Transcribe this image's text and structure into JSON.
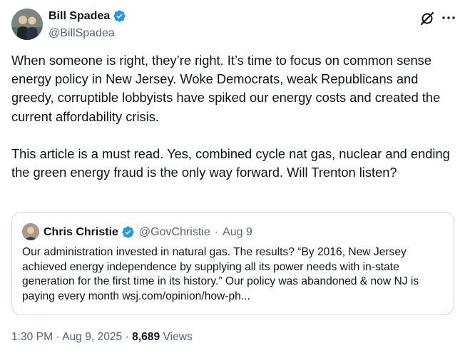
{
  "author": {
    "name": "Bill Spadea",
    "handle": "@BillSpadea"
  },
  "tweet": {
    "text": "When someone is right, they’re right. It’s time to focus on common sense energy policy in New Jersey. Woke Democrats, weak Republicans and greedy, corruptible lobbyists have spiked our energy costs and created the current affordability crisis.\n\nThis article is a must read. Yes, combined cycle nat gas, nuclear and ending the green energy fraud is the only way forward. Will Trenton listen?"
  },
  "quote": {
    "name": "Chris Christie",
    "handle": "@GovChristie",
    "date": "Aug 9",
    "text": "Our administration invested in natural gas. The results? “By 2016, New Jersey achieved energy independence by supplying all its power needs with in-state generation for the first time in its history.” Our policy was abandoned & now NJ is paying every month wsj.com/opinion/how-ph..."
  },
  "meta": {
    "time": "1:30 PM",
    "date": "Aug 9, 2025",
    "views_count": "8,689",
    "views_label": "Views",
    "separator": "·"
  },
  "colors": {
    "verified_blue": "#1d9bf0",
    "secondary_text": "#536471",
    "border": "#cfd9de"
  },
  "icons": [
    "verified-badge-icon",
    "grok-icon",
    "more-icon"
  ]
}
